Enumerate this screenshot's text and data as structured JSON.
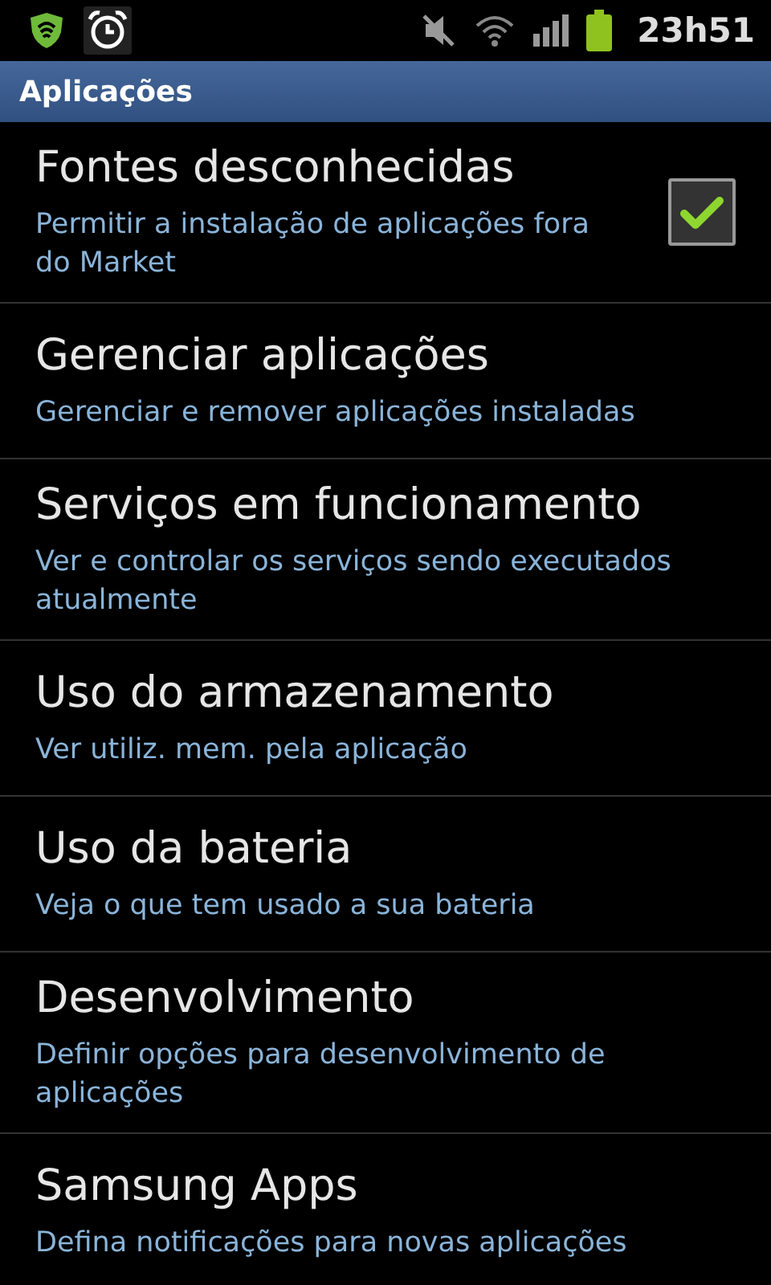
{
  "status_bar": {
    "time": "23h51"
  },
  "title_bar": {
    "title": "Aplicações"
  },
  "settings": [
    {
      "kind": "checkbox",
      "title": "Fontes desconhecidas",
      "summary": "Permitir a instalação de aplicações fora do Market",
      "checked": true
    },
    {
      "kind": "plain",
      "title": "Gerenciar aplicações",
      "summary": "Gerenciar e remover aplicações instaladas"
    },
    {
      "kind": "plain",
      "title": "Serviços em funcionamento",
      "summary": "Ver e controlar os serviços sendo executados atualmente"
    },
    {
      "kind": "plain",
      "title": "Uso do armazenamento",
      "summary": "Ver utiliz. mem. pela aplicação"
    },
    {
      "kind": "plain",
      "title": "Uso da bateria",
      "summary": "Veja o que tem usado a sua bateria"
    },
    {
      "kind": "plain",
      "title": "Desenvolvimento",
      "summary": "Definir opções para desenvolvimento de aplicações"
    },
    {
      "kind": "plain",
      "title": "Samsung Apps",
      "summary": "Defina notificações para novas aplicações"
    }
  ]
}
